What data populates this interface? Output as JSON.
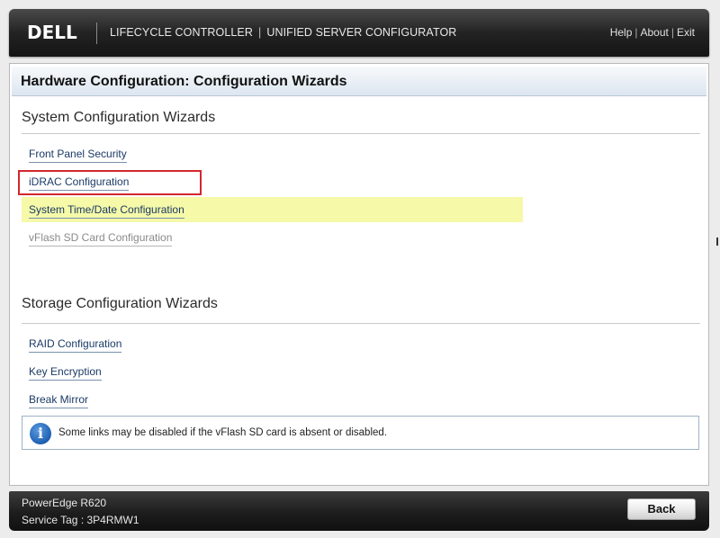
{
  "header": {
    "logo": "DELL",
    "product": "LIFECYCLE CONTROLLER",
    "product_separator": "|",
    "product_sub": "UNIFIED SERVER CONFIGURATOR",
    "links": [
      {
        "label": "Help"
      },
      {
        "label": "About"
      },
      {
        "label": "Exit"
      }
    ],
    "link_separator": "|"
  },
  "page": {
    "title": "Hardware Configuration: Configuration Wizards"
  },
  "system_section": {
    "title": "System Configuration Wizards",
    "links": [
      {
        "label": "Front Panel Security",
        "enabled": true
      },
      {
        "label": "iDRAC Configuration",
        "enabled": true,
        "annotated": true
      },
      {
        "label": "System Time/Date Configuration",
        "enabled": true,
        "hovered": true
      },
      {
        "label": "vFlash SD Card Configuration",
        "enabled": false
      }
    ]
  },
  "storage_section": {
    "title": "Storage Configuration Wizards",
    "links": [
      {
        "label": "RAID Configuration",
        "enabled": true
      },
      {
        "label": "Key Encryption",
        "enabled": true
      },
      {
        "label": "Break Mirror",
        "enabled": true
      }
    ]
  },
  "info": {
    "icon": "info-icon",
    "icon_glyph": "i",
    "text": "Some links may be disabled if the vFlash SD card is absent or disabled."
  },
  "footer": {
    "model": "PowerEdge R620",
    "service_tag": "Service Tag : 3P4RMW1",
    "back_label": "Back"
  },
  "colors": {
    "hover_highlight": "#f5f9a8",
    "annotation_box": "#d3262e",
    "link": "#1b3a66",
    "disabled_link": "#8a8a8a"
  }
}
